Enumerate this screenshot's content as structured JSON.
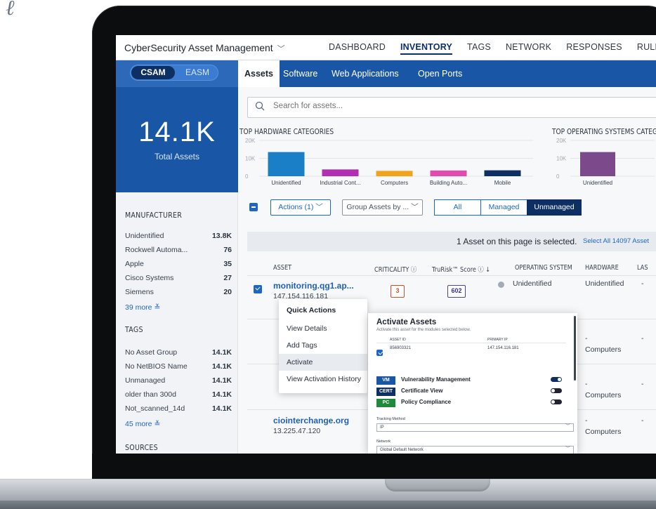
{
  "app": {
    "title": "CyberSecurity Asset Management"
  },
  "nav": [
    "DASHBOARD",
    "INVENTORY",
    "TAGS",
    "NETWORK",
    "RESPONSES",
    "RULES"
  ],
  "nav_active": "INVENTORY",
  "mode_toggle": {
    "on": "CSAM",
    "off": "EASM"
  },
  "summary": {
    "count": "14.1K",
    "label": "Total Assets"
  },
  "subtabs": [
    "Assets",
    "Software",
    "Web Applications",
    "Open Ports"
  ],
  "search": {
    "placeholder": "Search for assets..."
  },
  "facets": {
    "manufacturer": {
      "title": "MANUFACTURER",
      "rows": [
        {
          "name": "Unidentified",
          "count": "13.8K"
        },
        {
          "name": "Rockwell Automa...",
          "count": "76"
        },
        {
          "name": "Apple",
          "count": "35"
        },
        {
          "name": "Cisco Systems",
          "count": "27"
        },
        {
          "name": "Siemens",
          "count": "20"
        }
      ],
      "more": "39 more"
    },
    "tags": {
      "title": "TAGS",
      "rows": [
        {
          "name": "No Asset Group",
          "count": "14.1K"
        },
        {
          "name": "No NetBIOS Name",
          "count": "14.1K"
        },
        {
          "name": "Unmanaged",
          "count": "14.1K"
        },
        {
          "name": "older than 300d",
          "count": "14.1K"
        },
        {
          "name": "Not_scanned_14d",
          "count": "14.1K"
        }
      ],
      "more": "45 more"
    },
    "sources": {
      "title": "SOURCES"
    }
  },
  "chart_data": [
    {
      "type": "bar",
      "title": "TOP HARDWARE CATEGORIES",
      "categories": [
        "Unidentified",
        "Industrial Cont...",
        "Computers",
        "Building Auto...",
        "Mobile"
      ],
      "values": [
        13500,
        3800,
        3000,
        3200,
        3300
      ],
      "colors": [
        "#1a7fc6",
        "#b22fb3",
        "#f3a21b",
        "#e24bac",
        "#0e2f63"
      ],
      "ylim": [
        0,
        20000
      ],
      "yticks": [
        "20K",
        "10K",
        "0"
      ]
    },
    {
      "type": "bar",
      "title": "TOP OPERATING SYSTEMS CATEG",
      "categories": [
        "Unidentified"
      ],
      "values": [
        13500
      ],
      "colors": [
        "#7c4a8a"
      ],
      "ylim": [
        0,
        20000
      ],
      "yticks": [
        "20K",
        "10K",
        "0"
      ]
    }
  ],
  "toolbar": {
    "actions": "Actions (1)",
    "group_by": "Group Assets by ...",
    "filter_all": "All",
    "filter_managed": "Managed",
    "filter_unmanaged": "Unmanaged"
  },
  "selection_banner": {
    "message": "1 Asset on this page is selected.",
    "link": "Select All 14097 Asset"
  },
  "table": {
    "headers": {
      "asset": "ASSET",
      "criticality": "CRITICALITY",
      "trurisk": "TruRisk™ Score",
      "os": "OPERATING SYSTEM",
      "hardware": "HARDWARE",
      "last": "LAS"
    },
    "rows": [
      {
        "name": "monitoring.qg1.ap...",
        "ip": "147.154.116.181",
        "criticality": "3",
        "trurisk": "602",
        "os": "Unidentified",
        "hardware": "Unidentified",
        "last": "-"
      },
      {
        "os": "-",
        "hardware": "Computers",
        "last": "-"
      },
      {
        "os": "-",
        "hardware": "Computers",
        "last": "-"
      },
      {
        "name": "ciointerchange.org",
        "ip": "13.225.47.120",
        "os": "-",
        "hardware": "Computers",
        "last": "-"
      }
    ]
  },
  "quick_actions": {
    "title": "Quick Actions",
    "items": [
      "View Details",
      "Add Tags",
      "Activate",
      "View Activation History"
    ]
  },
  "activate_panel": {
    "title": "Activate Assets",
    "subtitle": "Activate this asset for the modules selected below.",
    "col_asset_id": "ASSET ID",
    "col_primary_ip": "PRIMARY IP",
    "asset_id": "856903321",
    "primary_ip": "147.154.116.181",
    "modules": [
      {
        "tag": "VM",
        "name": "Vulnerability Management",
        "tag_color": "#1a56a6",
        "enabled": true
      },
      {
        "tag": "CERT",
        "name": "Certificate View",
        "tag_color": "#0e2f63",
        "enabled": false
      },
      {
        "tag": "PC",
        "name": "Policy Compliance",
        "tag_color": "#1f8a3b",
        "enabled": false
      }
    ],
    "tracking_label": "Tracking Method",
    "tracking_value": "IP",
    "network_label": "Network",
    "network_value": "Global Default Network"
  }
}
